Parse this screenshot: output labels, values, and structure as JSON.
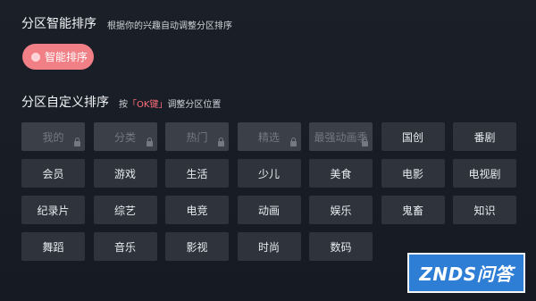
{
  "smart_sort": {
    "title": "分区智能排序",
    "description": "根据你的兴趣自动调整分区排序",
    "button_label": "智能排序"
  },
  "custom_sort": {
    "title": "分区自定义排序",
    "hint_prefix": "按",
    "hint_key": "「OK键」",
    "hint_suffix": "调整分区位置"
  },
  "tiles": [
    {
      "label": "我的",
      "locked": true
    },
    {
      "label": "分类",
      "locked": true
    },
    {
      "label": "热门",
      "locked": true
    },
    {
      "label": "精选",
      "locked": true
    },
    {
      "label": "最强动画季",
      "locked": true
    },
    {
      "label": "国创",
      "locked": false
    },
    {
      "label": "番剧",
      "locked": false
    },
    {
      "label": "会员",
      "locked": false
    },
    {
      "label": "游戏",
      "locked": false
    },
    {
      "label": "生活",
      "locked": false
    },
    {
      "label": "少儿",
      "locked": false
    },
    {
      "label": "美食",
      "locked": false
    },
    {
      "label": "电影",
      "locked": false
    },
    {
      "label": "电视剧",
      "locked": false
    },
    {
      "label": "纪录片",
      "locked": false
    },
    {
      "label": "综艺",
      "locked": false
    },
    {
      "label": "电竞",
      "locked": false
    },
    {
      "label": "动画",
      "locked": false
    },
    {
      "label": "娱乐",
      "locked": false
    },
    {
      "label": "鬼畜",
      "locked": false
    },
    {
      "label": "知识",
      "locked": false
    },
    {
      "label": "舞蹈",
      "locked": false
    },
    {
      "label": "音乐",
      "locked": false
    },
    {
      "label": "影视",
      "locked": false
    },
    {
      "label": "时尚",
      "locked": false
    },
    {
      "label": "数码",
      "locked": false
    }
  ],
  "watermark": {
    "text": "ZNDS问答"
  },
  "colors": {
    "accent": "#f07f86",
    "hint_key": "#ff6f7b",
    "tile": "#2e333c",
    "tile_locked": "#3b4048",
    "watermark_bg": "#2f7ed6"
  }
}
